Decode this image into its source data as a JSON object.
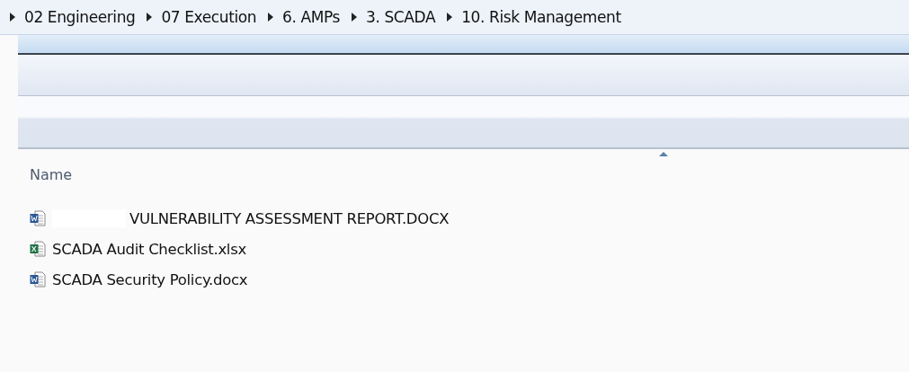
{
  "breadcrumb": [
    {
      "label": "02 Engineering"
    },
    {
      "label": "07 Execution"
    },
    {
      "label": "6. AMPs"
    },
    {
      "label": "3. SCADA"
    },
    {
      "label": "10. Risk Management"
    }
  ],
  "file_list": {
    "column": "Name",
    "sorted": true,
    "files": [
      {
        "kind": "word",
        "name": "VULNERABILITY ASSESSMENT REPORT.DOCX",
        "redacted": true
      },
      {
        "kind": "excel",
        "name": "SCADA Audit Checklist.xlsx",
        "redacted": false
      },
      {
        "kind": "word",
        "name": "SCADA Security Policy.docx",
        "redacted": false
      }
    ]
  }
}
